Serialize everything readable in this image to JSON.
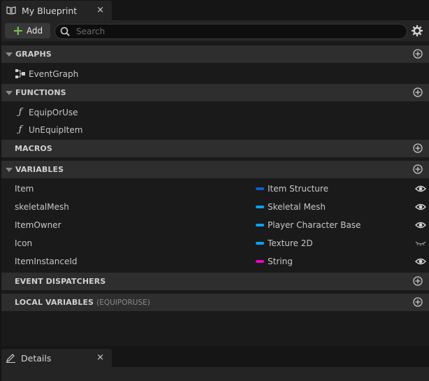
{
  "tab": {
    "title": "My Blueprint",
    "close": "×"
  },
  "toolbar": {
    "add_label": "Add",
    "search_placeholder": "Search"
  },
  "sections": {
    "graphs": {
      "title": "GRAPHS",
      "items": [
        {
          "label": "EventGraph"
        }
      ]
    },
    "functions": {
      "title": "FUNCTIONS",
      "items": [
        {
          "label": "EquipOrUse"
        },
        {
          "label": "UnEquipItem"
        }
      ]
    },
    "macros": {
      "title": "MACROS"
    },
    "variables": {
      "title": "VARIABLES",
      "items": [
        {
          "name": "Item",
          "type": "Item Structure",
          "color": "#0b5fd1",
          "visible": true
        },
        {
          "name": "skeletalMesh",
          "type": "Skeletal Mesh",
          "color": "#00a6f0",
          "visible": true
        },
        {
          "name": "ItemOwner",
          "type": "Player Character Base",
          "color": "#00a6f0",
          "visible": true
        },
        {
          "name": "Icon",
          "type": "Texture 2D",
          "color": "#00a6f0",
          "visible": false
        },
        {
          "name": "ItemInstanceId",
          "type": "String",
          "color": "#f000c8",
          "visible": true
        }
      ]
    },
    "event_dispatchers": {
      "title": "EVENT DISPATCHERS"
    },
    "local_variables": {
      "title": "LOCAL VARIABLES",
      "subtitle": "(EQUIPORUSE)"
    }
  },
  "details_tab": {
    "title": "Details",
    "close": "×"
  },
  "colors": {
    "add_plus": "#76c152",
    "panel_bg": "#1a1a1a",
    "section_bg": "#2e2e2e"
  }
}
